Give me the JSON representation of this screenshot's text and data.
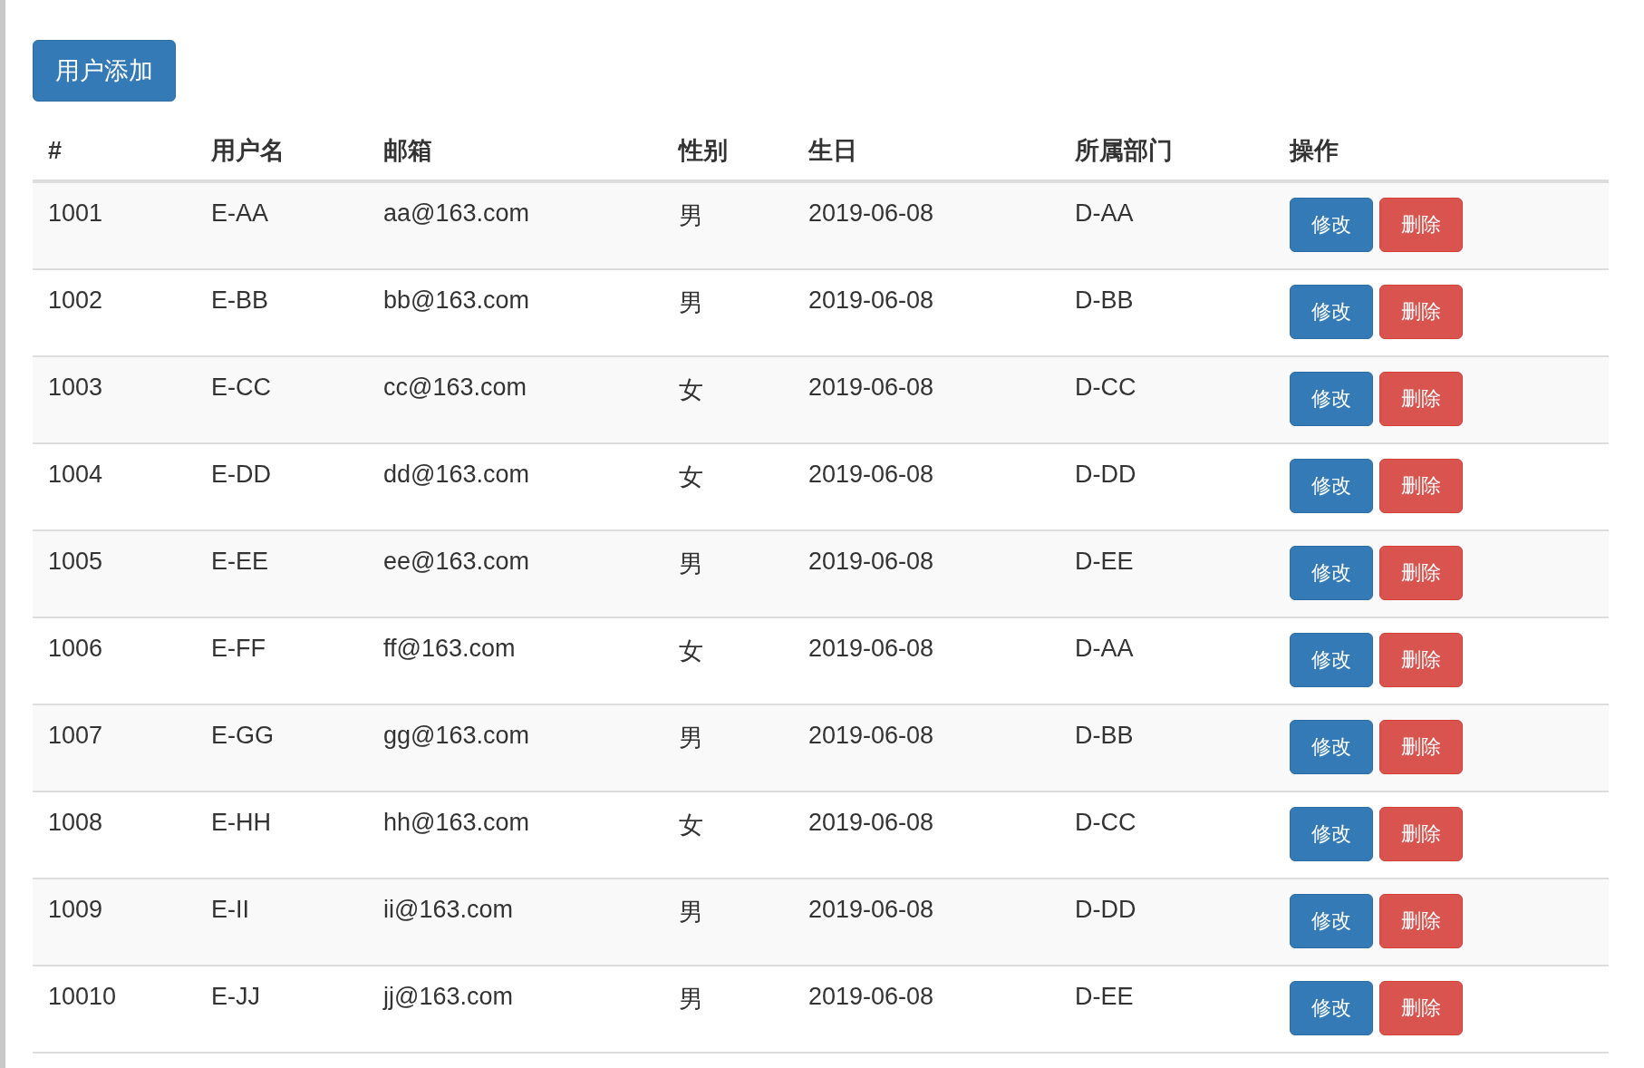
{
  "add_button": "用户添加",
  "table": {
    "columns": [
      "#",
      "用户名",
      "邮箱",
      "性别",
      "生日",
      "所属部门",
      "操作"
    ],
    "rows": [
      {
        "id": "1001",
        "name": "E-AA",
        "email": "aa@163.com",
        "gender": "男",
        "birthday": "2019-06-08",
        "department": "D-AA",
        "actions": [
          "修改",
          "删除"
        ]
      },
      {
        "id": "1002",
        "name": "E-BB",
        "email": "bb@163.com",
        "gender": "男",
        "birthday": "2019-06-08",
        "department": "D-BB",
        "actions": [
          "修改",
          "删除"
        ]
      },
      {
        "id": "1003",
        "name": "E-CC",
        "email": "cc@163.com",
        "gender": "女",
        "birthday": "2019-06-08",
        "department": "D-CC",
        "actions": [
          "修改",
          "删除"
        ]
      },
      {
        "id": "1004",
        "name": "E-DD",
        "email": "dd@163.com",
        "gender": "女",
        "birthday": "2019-06-08",
        "department": "D-DD",
        "actions": [
          "修改",
          "删除"
        ]
      },
      {
        "id": "1005",
        "name": "E-EE",
        "email": "ee@163.com",
        "gender": "男",
        "birthday": "2019-06-08",
        "department": "D-EE",
        "actions": [
          "修改",
          "删除"
        ]
      },
      {
        "id": "1006",
        "name": "E-FF",
        "email": "ff@163.com",
        "gender": "女",
        "birthday": "2019-06-08",
        "department": "D-AA",
        "actions": [
          "修改",
          "删除"
        ]
      },
      {
        "id": "1007",
        "name": "E-GG",
        "email": "gg@163.com",
        "gender": "男",
        "birthday": "2019-06-08",
        "department": "D-BB",
        "actions": [
          "修改",
          "删除"
        ]
      },
      {
        "id": "1008",
        "name": "E-HH",
        "email": "hh@163.com",
        "gender": "女",
        "birthday": "2019-06-08",
        "department": "D-CC",
        "actions": [
          "修改",
          "删除"
        ]
      },
      {
        "id": "1009",
        "name": "E-II",
        "email": "ii@163.com",
        "gender": "男",
        "birthday": "2019-06-08",
        "department": "D-DD",
        "actions": [
          "修改",
          "删除"
        ]
      },
      {
        "id": "10010",
        "name": "E-JJ",
        "email": "jj@163.com",
        "gender": "男",
        "birthday": "2019-06-08",
        "department": "D-EE",
        "actions": [
          "修改",
          "删除"
        ]
      }
    ]
  }
}
